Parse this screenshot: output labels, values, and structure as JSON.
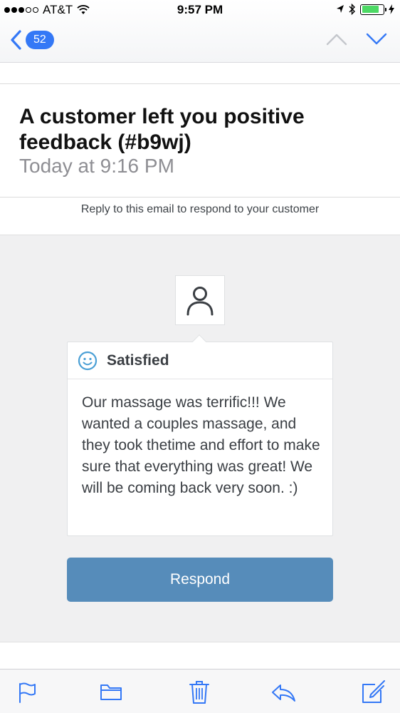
{
  "status_bar": {
    "carrier": "AT&T",
    "time": "9:57 PM",
    "signal_bars_filled": 3,
    "signal_bars_total": 5,
    "battery_level": 0.8
  },
  "nav": {
    "unread_count": "52",
    "accent_color": "#3478f6"
  },
  "email": {
    "subject": "A customer left you positive feedback (#b9wj)",
    "date": "Today at 9:16 PM",
    "reply_note": "Reply to this email to respond to your customer"
  },
  "feedback": {
    "avatar_icon": "person-icon",
    "rating_icon": "smiley-icon",
    "rating_label": "Satisfied",
    "text": "Our massage was terrific!!! We wanted a couples massage, and they took thetime and effort to make sure that everything was great! We will be coming back very soon. :)",
    "button_label": "Respond",
    "button_color": "#568cba"
  },
  "toolbar": {
    "items": [
      "flag-icon",
      "folder-icon",
      "trash-icon",
      "reply-icon",
      "compose-icon"
    ]
  }
}
